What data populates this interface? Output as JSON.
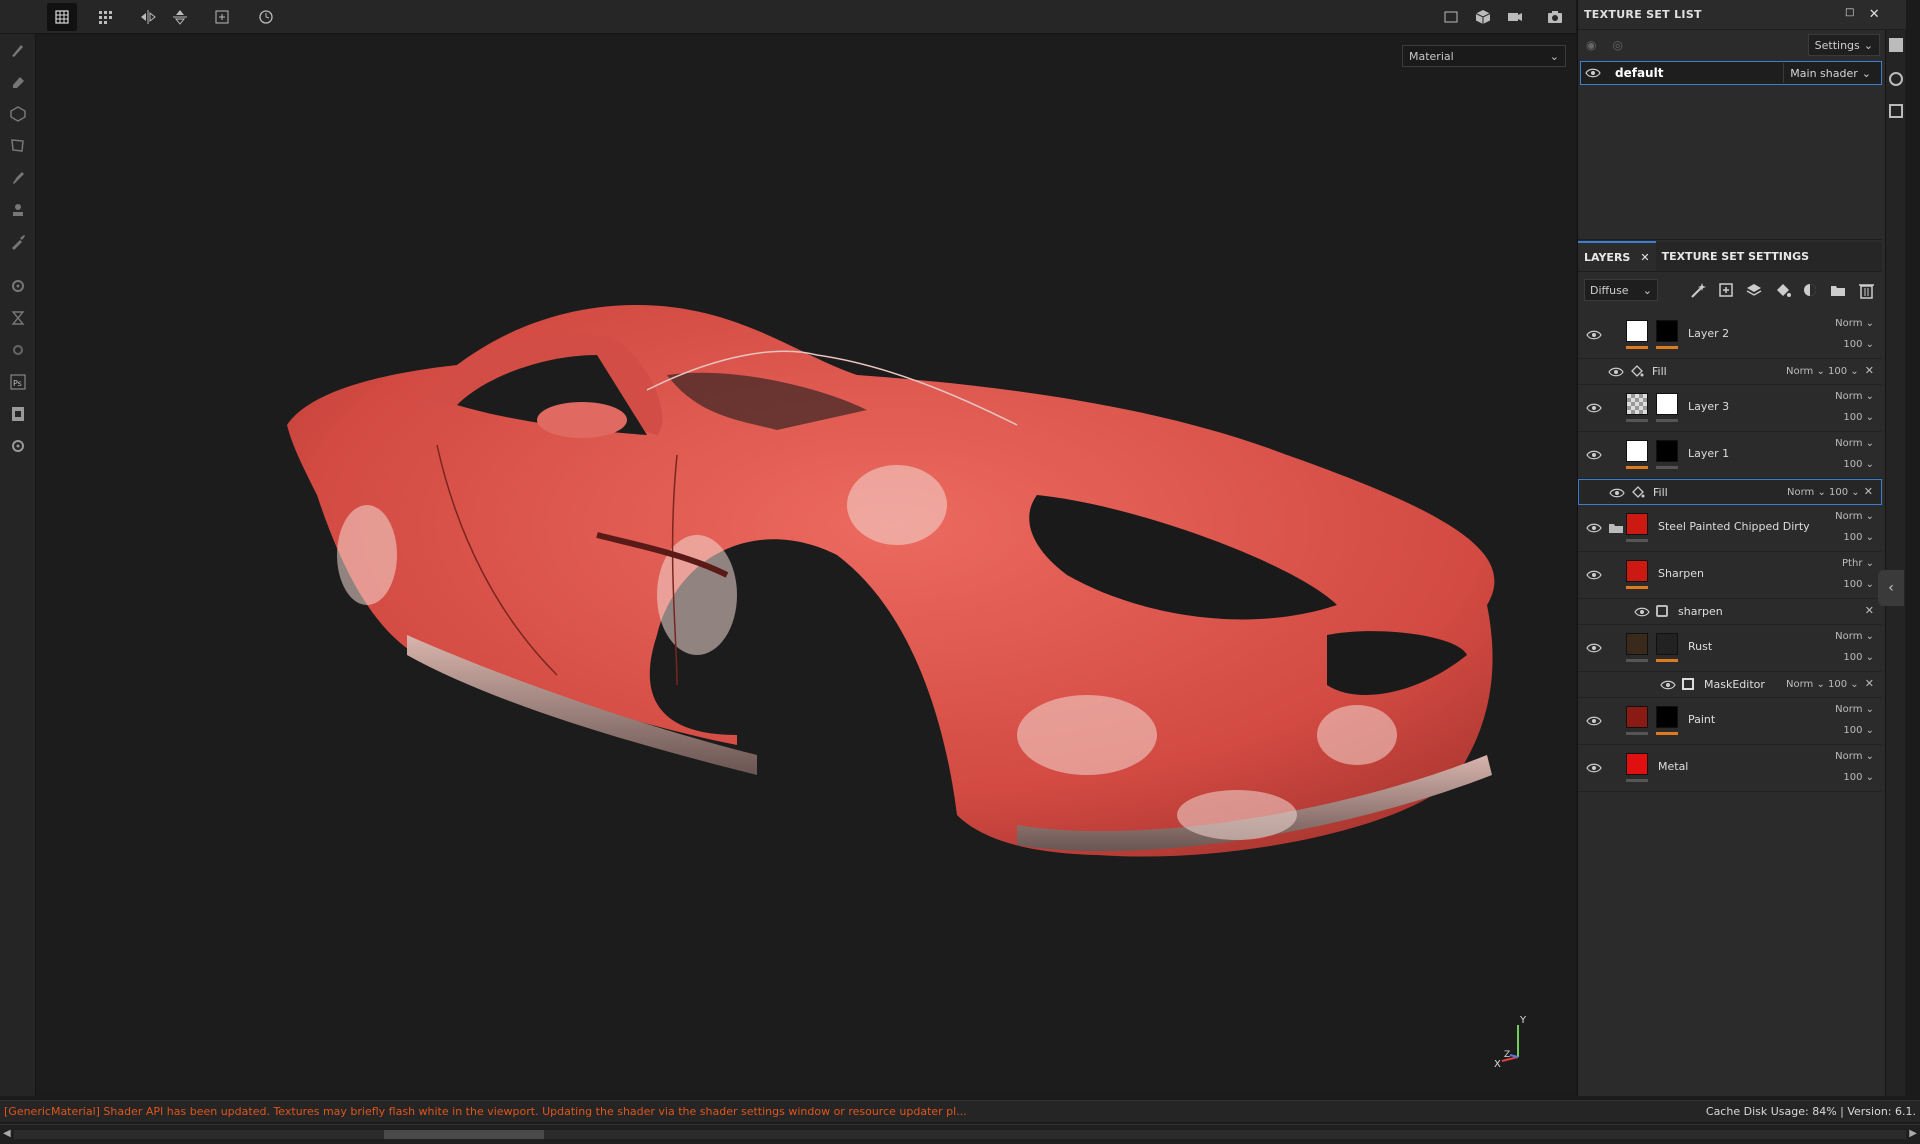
{
  "top_toolbar": {
    "icons": [
      "grid-select-icon",
      "grid-dots-icon",
      "mirror-x-icon",
      "mirror-y-icon",
      "add-frame-icon",
      "history-icon"
    ],
    "right_icons": [
      "view-2d-icon",
      "view-3d-icon",
      "camera-icon",
      "screenshot-icon"
    ]
  },
  "left_tools": [
    "brush-icon",
    "eraser-icon",
    "projection-icon",
    "polyfill-icon",
    "smudge-icon",
    "clone-icon",
    "picker-icon",
    "bake-icon",
    "geometry-icon",
    "settings-icon",
    "ps-icon",
    "export-icon",
    "plugin-icon"
  ],
  "viewport": {
    "material_select": "Material",
    "axis": {
      "y": "Y",
      "x": "X",
      "z": "Z"
    },
    "car_color": "#e0554c"
  },
  "texture_set_list": {
    "title": "TEXTURE SET LIST",
    "settings_label": "Settings",
    "rows": [
      {
        "name": "default",
        "shader": "Main shader"
      }
    ]
  },
  "layers_panel": {
    "tabs": [
      "LAYERS",
      "TEXTURE SET SETTINGS"
    ],
    "channel": "Diffuse",
    "layers": [
      {
        "name": "Layer 2",
        "blend": "Norm",
        "opacity": "100",
        "thumb": "#ffffff",
        "mask": "#000000",
        "bar1": "#e07a20",
        "bar2": "#e07a20"
      },
      {
        "sub": true,
        "name": "Fill",
        "blend": "Norm",
        "opacity": "100"
      },
      {
        "name": "Layer 3",
        "blend": "Norm",
        "opacity": "100",
        "thumb": "checker",
        "mask": "#ffffff",
        "bar1": "#555555",
        "bar2": "#555555"
      },
      {
        "name": "Layer 1",
        "blend": "Norm",
        "opacity": "100",
        "thumb": "#ffffff",
        "mask": "#000000",
        "bar1": "#e07a20",
        "bar2": "#555555"
      },
      {
        "sub": true,
        "selected": true,
        "name": "Fill",
        "blend": "Norm",
        "opacity": "100"
      },
      {
        "name": "Steel Painted Chipped Dirty",
        "blend": "Norm",
        "opacity": "100",
        "thumb": "#cc1a12",
        "folder": true,
        "bar1": "#555555"
      },
      {
        "name": "Sharpen",
        "blend": "Pthr",
        "opacity": "100",
        "thumb": "#cc1a12",
        "bar1": "#e07a20"
      },
      {
        "sub": true,
        "name": "sharpen",
        "noblend": true
      },
      {
        "name": "Rust",
        "blend": "Norm",
        "opacity": "100",
        "thumb": "#3a2a1c",
        "mask": "#222222",
        "bar1": "#555555",
        "bar2": "#e07a20"
      },
      {
        "sub": true,
        "name": "MaskEditor",
        "blend": "Norm",
        "opacity": "100",
        "deep": true
      },
      {
        "name": "Paint",
        "blend": "Norm",
        "opacity": "100",
        "thumb": "#8a1a14",
        "mask": "#000000",
        "bar1": "#555555",
        "bar2": "#e07a20"
      },
      {
        "name": "Metal",
        "blend": "Norm",
        "opacity": "100",
        "thumb": "#e01010",
        "bar1": "#555555"
      }
    ]
  },
  "status": {
    "message": "[GenericMaterial] Shader API has been updated. Textures may briefly flash white in the viewport. Updating the shader via the shader settings window or resource updater pl...",
    "cache": "Cache Disk Usage:    84% | Version: 6.1."
  }
}
